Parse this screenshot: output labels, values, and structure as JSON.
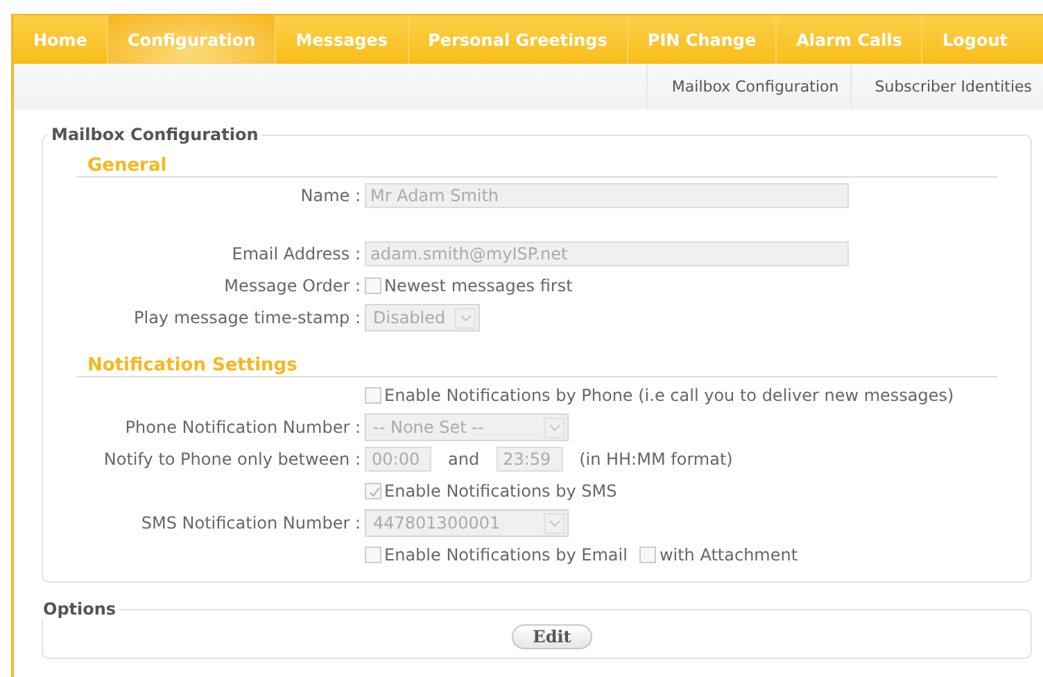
{
  "nav": {
    "tabs": [
      {
        "label": "Home",
        "selected": false
      },
      {
        "label": "Configuration",
        "selected": true
      },
      {
        "label": "Messages",
        "selected": false
      },
      {
        "label": "Personal Greetings",
        "selected": false
      },
      {
        "label": "PIN Change",
        "selected": false
      },
      {
        "label": "Alarm Calls",
        "selected": false
      },
      {
        "label": "Logout",
        "selected": false
      }
    ]
  },
  "subnav": {
    "links": [
      "Mailbox Configuration",
      "Subscriber Identities"
    ]
  },
  "mailbox": {
    "legend": "Mailbox Configuration",
    "sections": [
      {
        "heading": "General",
        "rows": [
          {
            "kind": "text",
            "label": "Name :",
            "value": "Mr Adam Smith"
          },
          {
            "kind": "text",
            "label": "Email Address :",
            "value": "adam.smith@myISP.net"
          },
          {
            "kind": "check",
            "label": "Message Order :",
            "checks": [
              {
                "text": "Newest messages first",
                "checked": false
              }
            ]
          },
          {
            "kind": "select",
            "label": "Play message time-stamp :",
            "value": "Disabled"
          }
        ]
      },
      {
        "heading": "Notification Settings",
        "rows": [
          {
            "kind": "check",
            "checks": [
              {
                "text": "Enable Notifications by Phone (i.e call you to deliver new messages)",
                "checked": false
              }
            ]
          },
          {
            "kind": "select",
            "label": "Phone Notification Number :",
            "value": "-- None Set --"
          },
          {
            "kind": "time",
            "label": "Notify to Phone only between :",
            "from": "00:00",
            "joiner": "and",
            "to": "23:59",
            "hint": "(in HH:MM format)"
          },
          {
            "kind": "check",
            "checks": [
              {
                "text": "Enable Notifications by SMS",
                "checked": true
              }
            ]
          },
          {
            "kind": "select",
            "label": "SMS Notification Number :",
            "value": "447801300001"
          },
          {
            "kind": "check",
            "checks": [
              {
                "text": "Enable Notifications by Email",
                "checked": false
              },
              {
                "text": "with Attachment",
                "checked": false
              }
            ]
          }
        ]
      }
    ]
  },
  "options": {
    "legend": "Options",
    "button": "Edit"
  }
}
